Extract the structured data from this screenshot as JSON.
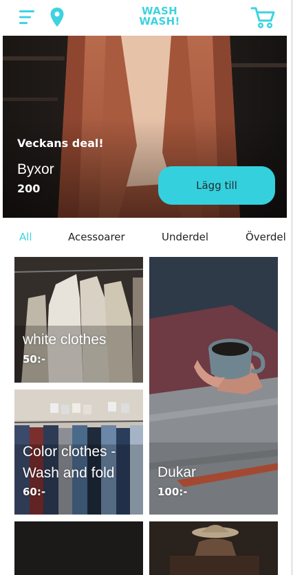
{
  "header": {
    "brand_line1": "WASH",
    "brand_line2": "WASH!",
    "menu_icon": "hamburger-menu-icon",
    "location_icon": "location-pin-icon",
    "cart_icon": "shopping-cart-icon",
    "accent_color": "#3dd3e0"
  },
  "deal": {
    "tag": "Veckans deal!",
    "name": "Byxor",
    "price": "200",
    "button_label": "Lägg till",
    "button_color": "#35d0de"
  },
  "tabs": [
    {
      "label": "All",
      "active": true
    },
    {
      "label": "Acessoarer",
      "active": false
    },
    {
      "label": "Underdel",
      "active": false
    },
    {
      "label": "Överdel",
      "active": false
    }
  ],
  "products": [
    {
      "title": "white clothes",
      "price": "50:-"
    },
    {
      "title_line1": "Color clothes -",
      "title_line2": "Wash and fold",
      "price": "60:-"
    },
    {
      "title": "Dukar",
      "price": "100:-"
    }
  ]
}
